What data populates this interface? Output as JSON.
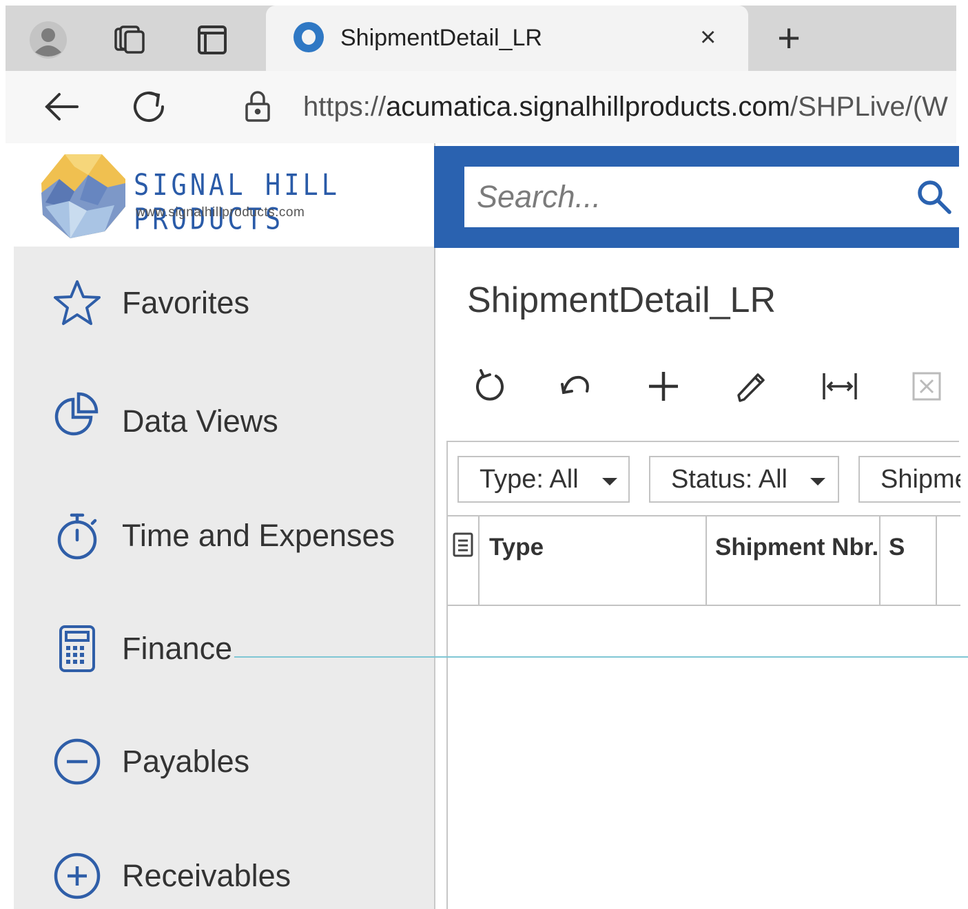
{
  "browser": {
    "tab": {
      "title": "ShipmentDetail_LR",
      "close": "×"
    },
    "new_tab": "+",
    "url": {
      "scheme": "https://",
      "host": "acumatica.signalhillproducts.com",
      "path": "/SHPLive/(W"
    }
  },
  "logo": {
    "name": "SIGNAL HILL PRODUCTS",
    "url": "www.signalhillproducts.com"
  },
  "sidebar": {
    "items": [
      {
        "label": "Favorites",
        "icon": "star-icon"
      },
      {
        "label": "Data Views",
        "icon": "pie-chart-icon"
      },
      {
        "label": "Time and Expenses",
        "icon": "stopwatch-icon"
      },
      {
        "label": "Finance",
        "icon": "calculator-icon"
      },
      {
        "label": "Payables",
        "icon": "minus-circle-icon"
      },
      {
        "label": "Receivables",
        "icon": "plus-circle-icon"
      }
    ]
  },
  "search": {
    "placeholder": "Search..."
  },
  "page": {
    "title": "ShipmentDetail_LR"
  },
  "toolbar": [
    "refresh-icon",
    "undo-icon",
    "add-icon",
    "edit-icon",
    "fit-columns-icon",
    "export-excel-icon"
  ],
  "filters": [
    {
      "label": "Type: All"
    },
    {
      "label": "Status: All"
    },
    {
      "label": "Shipme"
    }
  ],
  "grid": {
    "columns": [
      {
        "label": "Type"
      },
      {
        "label": "Shipment Nbr."
      },
      {
        "label": "S"
      }
    ]
  },
  "colors": {
    "topbar": "#2a62b0",
    "accent_icon": "#2f5ea8",
    "sidebar_bg": "#ebebeb"
  }
}
